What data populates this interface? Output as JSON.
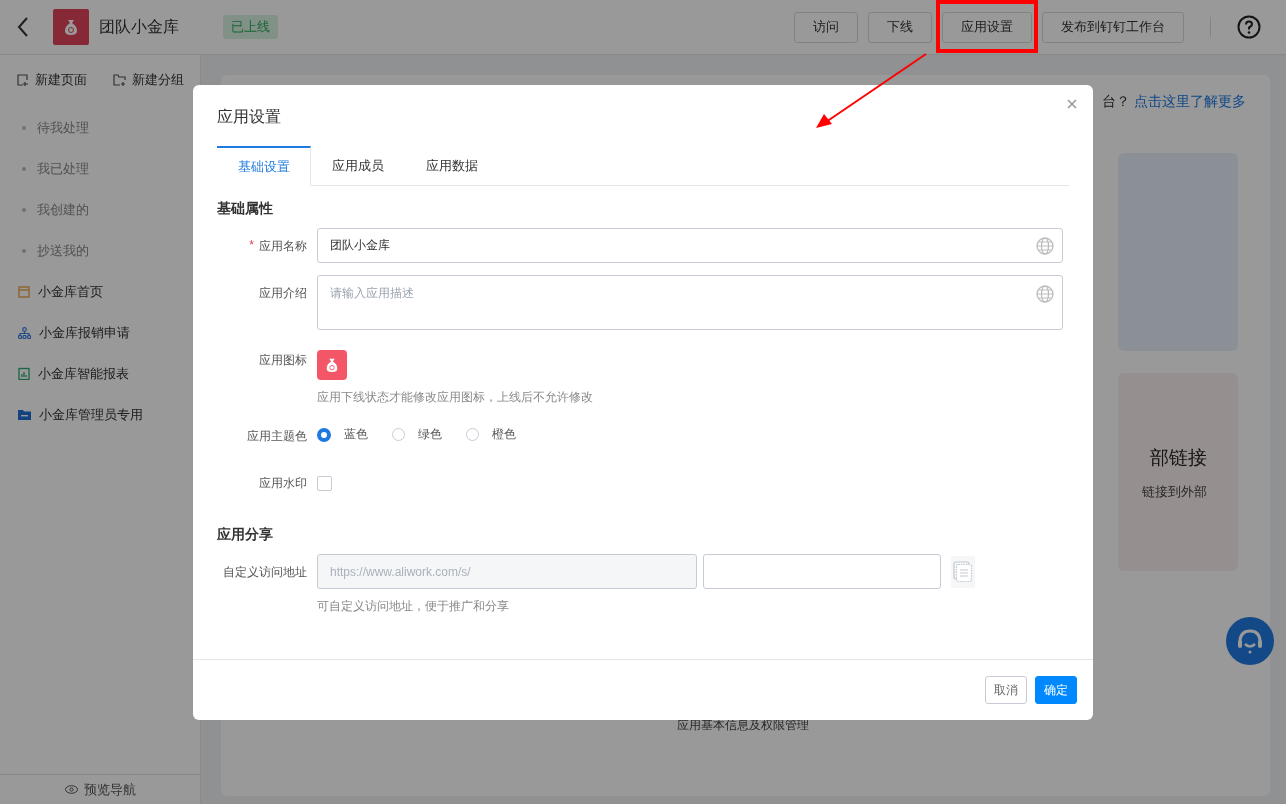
{
  "header": {
    "app_name": "团队小金库",
    "status": "已上线",
    "actions": [
      {
        "label": "访问",
        "highlighted": false
      },
      {
        "label": "下线",
        "highlighted": false
      },
      {
        "label": "应用设置",
        "highlighted": true
      },
      {
        "label": "发布到钉钉工作台",
        "highlighted": false
      }
    ]
  },
  "sidebar": {
    "tools": [
      {
        "kind": "page",
        "label": "新建页面"
      },
      {
        "kind": "group",
        "label": "新建分组"
      }
    ],
    "items": [
      {
        "kind": "dot",
        "label": "待我处理"
      },
      {
        "kind": "dot",
        "label": "我已处理"
      },
      {
        "kind": "dot",
        "label": "我创建的"
      },
      {
        "kind": "dot",
        "label": "抄送我的"
      },
      {
        "kind": "page",
        "label": "小金库首页"
      },
      {
        "kind": "flow",
        "label": "小金库报销申请"
      },
      {
        "kind": "report",
        "label": "小金库智能报表"
      },
      {
        "kind": "folder",
        "label": "小金库管理员专用"
      }
    ],
    "footer": "预览导航"
  },
  "main": {
    "notice": "台？",
    "notice_link": "点击这里了解更多",
    "card_title": "部链接",
    "card_desc": "链接到外部",
    "footer_text": "应用基本信息及权限管理"
  },
  "modal": {
    "title": "应用设置",
    "required_mark": "*",
    "tabs": [
      {
        "label": "基础设置",
        "selected": true
      },
      {
        "label": "应用成员",
        "selected": false
      },
      {
        "label": "应用数据",
        "selected": false
      }
    ],
    "sections": [
      {
        "title": "基础属性",
        "fields": [
          {
            "kind": "text",
            "label": "应用名称",
            "required": true,
            "value": "团队小金库"
          },
          {
            "kind": "textarea",
            "label": "应用介绍",
            "required": false,
            "placeholder": "请输入应用描述"
          },
          {
            "kind": "icon",
            "label": "应用图标",
            "required": false,
            "hint": "应用下线状态才能修改应用图标，上线后不允许修改"
          },
          {
            "kind": "radio",
            "label": "应用主题色",
            "required": false,
            "options": [
              {
                "label": "蓝色",
                "selected": true
              },
              {
                "label": "绿色",
                "selected": false
              },
              {
                "label": "橙色",
                "selected": false
              }
            ]
          },
          {
            "kind": "checkbox",
            "label": "应用水印",
            "required": false,
            "checked": false
          }
        ]
      },
      {
        "title": "应用分享",
        "fields": [
          {
            "kind": "url",
            "label": "自定义访问地址",
            "required": false,
            "prefix": "https://www.aliwork.com/s/",
            "hint": "可自定义访问地址，便于推广和分享"
          }
        ]
      }
    ],
    "buttons": [
      {
        "kind": "cancel",
        "label": "取消"
      },
      {
        "kind": "ok",
        "label": "确定"
      }
    ]
  }
}
